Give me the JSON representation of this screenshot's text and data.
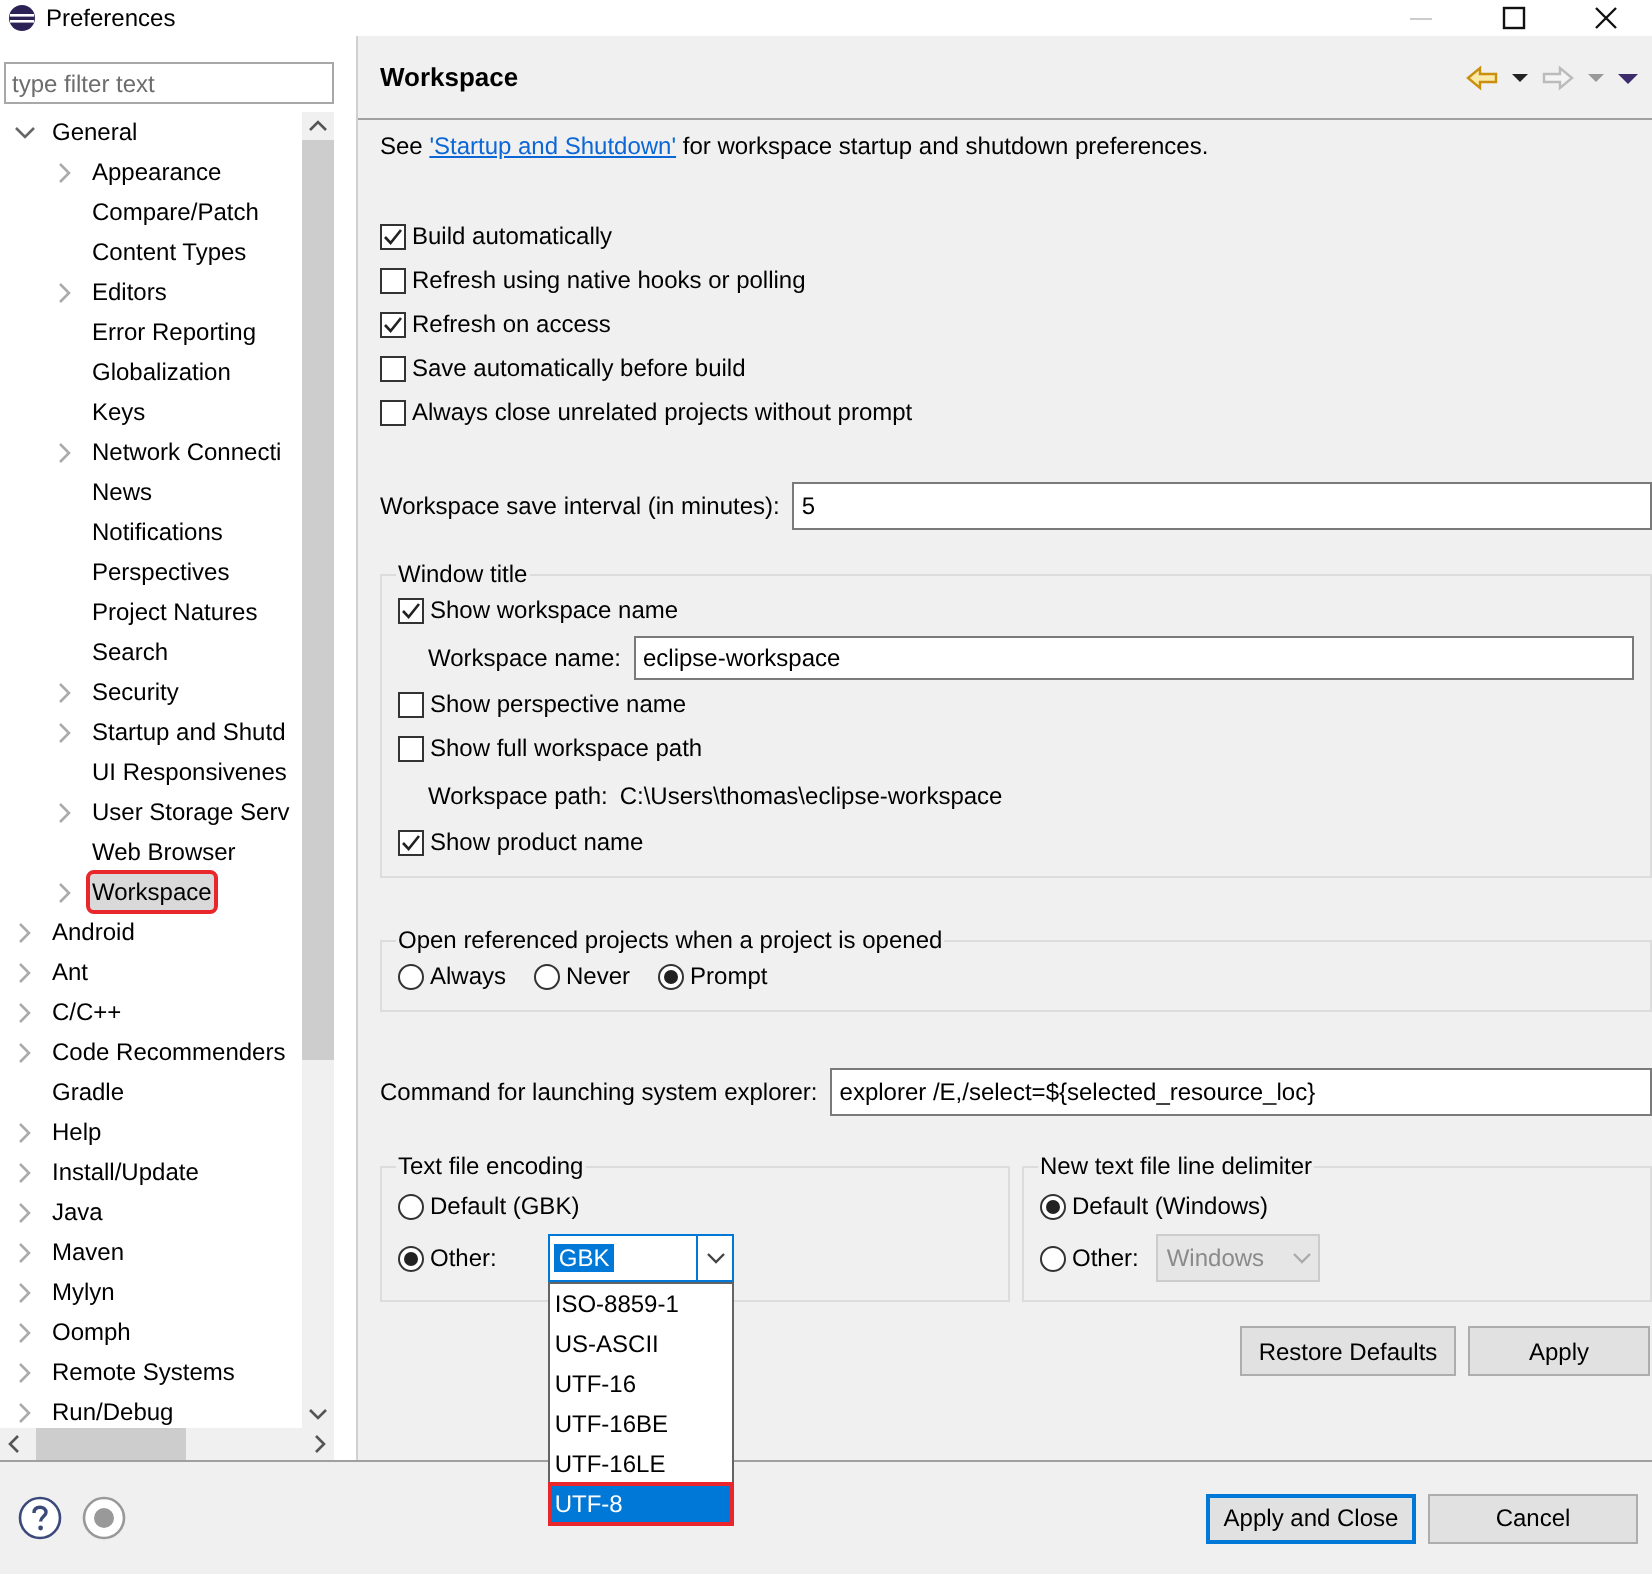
{
  "window": {
    "title": "Preferences"
  },
  "sidebar": {
    "filter": {
      "placeholder": "type filter text"
    },
    "tree": [
      {
        "label": "General",
        "expandable": true,
        "expanded": true,
        "selected": false,
        "children": [
          {
            "label": "Appearance",
            "expandable": true,
            "expanded": false,
            "selected": false
          },
          {
            "label": "Compare/Patch",
            "expandable": false,
            "selected": false
          },
          {
            "label": "Content Types",
            "expandable": false,
            "selected": false
          },
          {
            "label": "Editors",
            "expandable": true,
            "expanded": false,
            "selected": false
          },
          {
            "label": "Error Reporting",
            "expandable": false,
            "selected": false
          },
          {
            "label": "Globalization",
            "expandable": false,
            "selected": false
          },
          {
            "label": "Keys",
            "expandable": false,
            "selected": false
          },
          {
            "label": "Network Connecti",
            "expandable": true,
            "expanded": false,
            "selected": false
          },
          {
            "label": "News",
            "expandable": false,
            "selected": false
          },
          {
            "label": "Notifications",
            "expandable": false,
            "selected": false
          },
          {
            "label": "Perspectives",
            "expandable": false,
            "selected": false
          },
          {
            "label": "Project Natures",
            "expandable": false,
            "selected": false
          },
          {
            "label": "Search",
            "expandable": false,
            "selected": false
          },
          {
            "label": "Security",
            "expandable": true,
            "expanded": false,
            "selected": false
          },
          {
            "label": "Startup and Shutd",
            "expandable": true,
            "expanded": false,
            "selected": false
          },
          {
            "label": "UI Responsivenes",
            "expandable": false,
            "selected": false
          },
          {
            "label": "User Storage Serv",
            "expandable": true,
            "expanded": false,
            "selected": false
          },
          {
            "label": "Web Browser",
            "expandable": false,
            "selected": false
          },
          {
            "label": "Workspace",
            "expandable": true,
            "expanded": false,
            "selected": true,
            "highlighted": true
          }
        ]
      },
      {
        "label": "Android",
        "expandable": true,
        "expanded": false,
        "selected": false
      },
      {
        "label": "Ant",
        "expandable": true,
        "expanded": false,
        "selected": false
      },
      {
        "label": "C/C++",
        "expandable": true,
        "expanded": false,
        "selected": false
      },
      {
        "label": "Code Recommenders",
        "expandable": true,
        "expanded": false,
        "selected": false
      },
      {
        "label": "Gradle",
        "expandable": false,
        "selected": false
      },
      {
        "label": "Help",
        "expandable": true,
        "expanded": false,
        "selected": false
      },
      {
        "label": "Install/Update",
        "expandable": true,
        "expanded": false,
        "selected": false
      },
      {
        "label": "Java",
        "expandable": true,
        "expanded": false,
        "selected": false
      },
      {
        "label": "Maven",
        "expandable": true,
        "expanded": false,
        "selected": false
      },
      {
        "label": "Mylyn",
        "expandable": true,
        "expanded": false,
        "selected": false
      },
      {
        "label": "Oomph",
        "expandable": true,
        "expanded": false,
        "selected": false
      },
      {
        "label": "Remote Systems",
        "expandable": true,
        "expanded": false,
        "selected": false
      },
      {
        "label": "Run/Debug",
        "expandable": true,
        "expanded": false,
        "selected": false
      }
    ]
  },
  "page": {
    "title": "Workspace",
    "intro": {
      "before": "See ",
      "link": "'Startup and Shutdown'",
      "after": " for workspace startup and shutdown preferences."
    },
    "checkboxes": [
      {
        "label": "Build automatically",
        "checked": true
      },
      {
        "label": "Refresh using native hooks or polling",
        "checked": false
      },
      {
        "label": "Refresh on access",
        "checked": true
      },
      {
        "label": "Save automatically before build",
        "checked": false
      },
      {
        "label": "Always close unrelated projects without prompt",
        "checked": false
      }
    ],
    "save_interval": {
      "label": "Workspace save interval (in minutes):",
      "value": "5"
    },
    "window_title": {
      "title": "Window title",
      "items": [
        {
          "kind": "checkbox",
          "label": "Show workspace name",
          "checked": true
        },
        {
          "kind": "field",
          "label": "Workspace name:",
          "value": "eclipse-workspace"
        },
        {
          "kind": "checkbox",
          "label": "Show perspective name",
          "checked": false
        },
        {
          "kind": "checkbox",
          "label": "Show full workspace path",
          "checked": false
        },
        {
          "kind": "text",
          "label": "Workspace path:",
          "value": "C:\\Users\\thomas\\eclipse-workspace"
        },
        {
          "kind": "checkbox",
          "label": "Show product name",
          "checked": true
        }
      ]
    },
    "open_referenced": {
      "title": "Open referenced projects when a project is opened",
      "options": [
        {
          "label": "Always",
          "selected": false
        },
        {
          "label": "Never",
          "selected": false
        },
        {
          "label": "Prompt",
          "selected": true
        }
      ]
    },
    "explorer_command": {
      "label": "Command for launching system explorer:",
      "value": "explorer /E,/select=${selected_resource_loc}"
    },
    "encoding": {
      "title": "Text file encoding",
      "options": [
        {
          "label": "Default (GBK)",
          "selected": false
        },
        {
          "label": "Other:",
          "selected": true,
          "combo": {
            "value": "GBK",
            "disabled": false,
            "open": true,
            "items": [
              {
                "label": "ISO-8859-1",
                "selected": false
              },
              {
                "label": "US-ASCII",
                "selected": false
              },
              {
                "label": "UTF-16",
                "selected": false
              },
              {
                "label": "UTF-16BE",
                "selected": false
              },
              {
                "label": "UTF-16LE",
                "selected": false
              },
              {
                "label": "UTF-8",
                "selected": true,
                "highlighted": true
              }
            ]
          }
        }
      ]
    },
    "line_delimiter": {
      "title": "New text file line delimiter",
      "options": [
        {
          "label": "Default (Windows)",
          "selected": true
        },
        {
          "label": "Other:",
          "selected": false,
          "combo": {
            "value": "Windows",
            "disabled": true,
            "open": false
          }
        }
      ]
    },
    "buttons": [
      {
        "label": "Restore Defaults"
      },
      {
        "label": "Apply"
      }
    ]
  },
  "footer": {
    "buttons": [
      {
        "label": "Apply and Close",
        "default": true
      },
      {
        "label": "Cancel",
        "default": false
      }
    ]
  }
}
